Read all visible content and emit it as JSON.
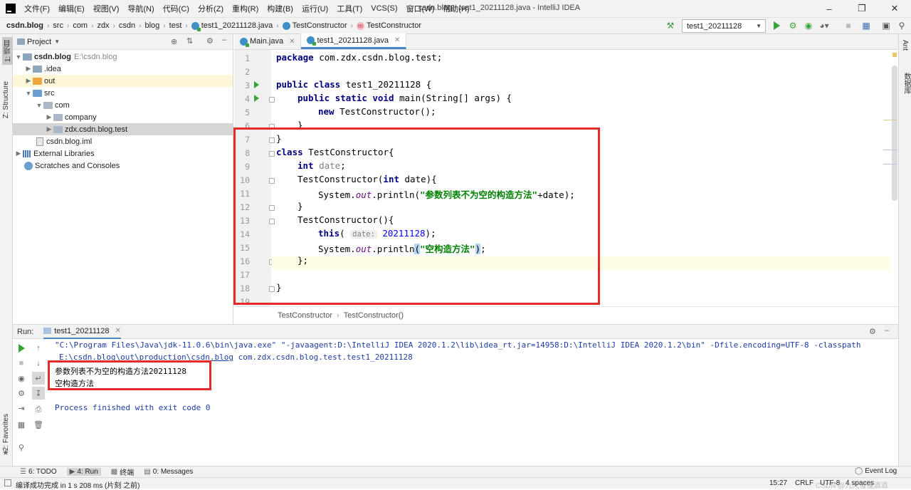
{
  "titlebar": {
    "menu": [
      "文件(F)",
      "编辑(E)",
      "视图(V)",
      "导航(N)",
      "代码(C)",
      "分析(Z)",
      "重构(R)",
      "构建(B)",
      "运行(U)",
      "工具(T)",
      "VCS(S)",
      "窗口(W)",
      "帮助(H)"
    ],
    "window_title": "csdn.blog - test1_20211128.java - IntelliJ IDEA"
  },
  "navbar": {
    "crumbs": [
      "csdn.blog",
      "src",
      "com",
      "zdx",
      "csdn",
      "blog",
      "test"
    ],
    "file": "test1_20211128.java",
    "class1": "TestConstructor",
    "method": "TestConstructor",
    "run_config": "test1_20211128"
  },
  "left_strip": {
    "project_tab": "1: 项目",
    "structure_tab": "Z: Structure",
    "favorites_tab": "2: Favorites"
  },
  "right_strip": {
    "ant_tab": "Ant",
    "database_tab": "数据库"
  },
  "project_panel": {
    "title": "Project",
    "tree": [
      {
        "label": "csdn.blog",
        "extra": "E:\\csdn.blog"
      },
      {
        "label": ".idea"
      },
      {
        "label": "out"
      },
      {
        "label": "src"
      },
      {
        "label": "com"
      },
      {
        "label": "company"
      },
      {
        "label": "zdx.csdn.blog.test"
      },
      {
        "label": "csdn.blog.iml"
      },
      {
        "label": "External Libraries"
      },
      {
        "label": "Scratches and Consoles"
      }
    ]
  },
  "editor": {
    "tabs": [
      "Main.java",
      "test1_20211128.java"
    ],
    "line_numbers": [
      "1",
      "2",
      "3",
      "4",
      "5",
      "6",
      "7",
      "8",
      "9",
      "10",
      "11",
      "12",
      "13",
      "14",
      "15",
      "16",
      "17",
      "18",
      "19"
    ],
    "code": {
      "l1_kw": "package",
      "l1_rest": " com.zdx.csdn.blog.test;",
      "l3_kw1": "public",
      "l3_kw2": "class",
      "l3_rest": " test1_20211128 {",
      "l4_kw1": "public",
      "l4_kw2": "static",
      "l4_kw3": "void",
      "l4_rest": " main(String[] args) {",
      "l5_kw": "new",
      "l5_rest": " TestConstructor();",
      "l6": "}",
      "l7": "}",
      "l8_kw": "class",
      "l8_rest": " TestConstructor{",
      "l9_kw": "int",
      "l9_var": "date",
      "l9_end": ";",
      "l10_a": "TestConstructor(",
      "l10_kw": "int",
      "l10_b": " date){",
      "l11_a": "System.",
      "l11_fld": "out",
      "l11_b": ".println(",
      "l11_str": "\"参数列表不为空的构造方法\"",
      "l11_c": "+date);",
      "l12": "}",
      "l13": "TestConstructor(){",
      "l14_kw": "this",
      "l14_a": "( ",
      "l14_hint": "date:",
      "l14_num": "20211128",
      "l14_b": ");",
      "l15_a": "System.",
      "l15_fld": "out",
      "l15_b": ".println",
      "l15_p1": "(",
      "l15_str": "\"空构造方法\"",
      "l15_p2": ")",
      "l15_c": ";",
      "l16": "};",
      "l18": "}"
    },
    "breadcrumb": [
      "TestConstructor",
      "TestConstructor()"
    ]
  },
  "run_panel": {
    "label": "Run:",
    "tab": "test1_20211128",
    "cmd1": "\"C:\\Program Files\\Java\\jdk-11.0.6\\bin\\java.exe\" \"-javaagent:D:\\IntelliJ IDEA 2020.1.2\\lib\\idea_rt.jar=14958:D:\\IntelliJ IDEA 2020.1.2\\bin\" -Dfile.encoding=UTF-8 -classpath",
    "cmd2_path": "E:\\csdn.blog\\out\\production\\csdn.blog",
    "cmd2_rest": " com.zdx.csdn.blog.test.test1_20211128",
    "out1": "参数列表不为空的构造方法20211128",
    "out2": "空构造方法",
    "finish": "Process finished with exit code 0"
  },
  "bottom_tabs": {
    "todo": "6: TODO",
    "run": "4: Run",
    "terminal": "终端",
    "messages": "0: Messages",
    "event_log": "Event Log"
  },
  "status": {
    "message": "编译成功完成 in 1 s 208 ms (片刻 之前)",
    "position": "15:27",
    "line_sep": "CRLF",
    "encoding": "UTF-8",
    "indent": "4 spaces",
    "watermark": "CSDN @九九慢慢酒酒"
  },
  "colors": {
    "accent_red": "#e52a2a",
    "run_green": "#36a437",
    "keyword": "#000080",
    "string": "#008000"
  }
}
